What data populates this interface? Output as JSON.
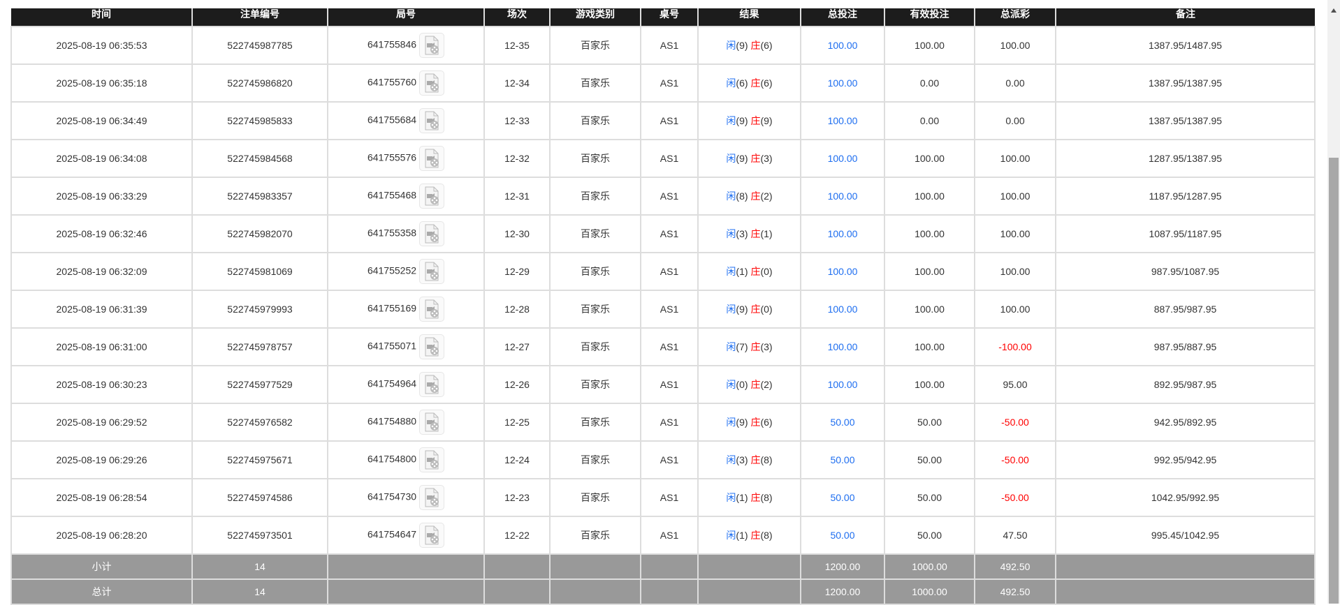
{
  "headers": [
    "时间",
    "注单编号",
    "局号",
    "场次",
    "游戏类别",
    "桌号",
    "结果",
    "总投注",
    "有效投注",
    "总派彩",
    "备注"
  ],
  "result_labels": {
    "player": "闲",
    "banker": "庄"
  },
  "colors": {
    "header_bg": "#1c1c1c",
    "summary_bg": "#999999",
    "blue": "#1e6ef0",
    "red": "#ff0000"
  },
  "rows": [
    {
      "time": "2025-08-19 06:35:53",
      "bet_id": "522745987785",
      "round": "641755846",
      "shoe": "12-35",
      "game": "百家乐",
      "table": "AS1",
      "player": "(9)",
      "banker": "(6)",
      "total_bet": "100.00",
      "valid_bet": "100.00",
      "payout": "100.00",
      "payout_negative": false,
      "note": "1387.95/1487.95"
    },
    {
      "time": "2025-08-19 06:35:18",
      "bet_id": "522745986820",
      "round": "641755760",
      "shoe": "12-34",
      "game": "百家乐",
      "table": "AS1",
      "player": "(6)",
      "banker": "(6)",
      "total_bet": "100.00",
      "valid_bet": "0.00",
      "payout": "0.00",
      "payout_negative": false,
      "note": "1387.95/1387.95"
    },
    {
      "time": "2025-08-19 06:34:49",
      "bet_id": "522745985833",
      "round": "641755684",
      "shoe": "12-33",
      "game": "百家乐",
      "table": "AS1",
      "player": "(9)",
      "banker": "(9)",
      "total_bet": "100.00",
      "valid_bet": "0.00",
      "payout": "0.00",
      "payout_negative": false,
      "note": "1387.95/1387.95"
    },
    {
      "time": "2025-08-19 06:34:08",
      "bet_id": "522745984568",
      "round": "641755576",
      "shoe": "12-32",
      "game": "百家乐",
      "table": "AS1",
      "player": "(9)",
      "banker": "(3)",
      "total_bet": "100.00",
      "valid_bet": "100.00",
      "payout": "100.00",
      "payout_negative": false,
      "note": "1287.95/1387.95"
    },
    {
      "time": "2025-08-19 06:33:29",
      "bet_id": "522745983357",
      "round": "641755468",
      "shoe": "12-31",
      "game": "百家乐",
      "table": "AS1",
      "player": "(8)",
      "banker": "(2)",
      "total_bet": "100.00",
      "valid_bet": "100.00",
      "payout": "100.00",
      "payout_negative": false,
      "note": "1187.95/1287.95"
    },
    {
      "time": "2025-08-19 06:32:46",
      "bet_id": "522745982070",
      "round": "641755358",
      "shoe": "12-30",
      "game": "百家乐",
      "table": "AS1",
      "player": "(3)",
      "banker": "(1)",
      "total_bet": "100.00",
      "valid_bet": "100.00",
      "payout": "100.00",
      "payout_negative": false,
      "note": "1087.95/1187.95"
    },
    {
      "time": "2025-08-19 06:32:09",
      "bet_id": "522745981069",
      "round": "641755252",
      "shoe": "12-29",
      "game": "百家乐",
      "table": "AS1",
      "player": "(1)",
      "banker": "(0)",
      "total_bet": "100.00",
      "valid_bet": "100.00",
      "payout": "100.00",
      "payout_negative": false,
      "note": "987.95/1087.95"
    },
    {
      "time": "2025-08-19 06:31:39",
      "bet_id": "522745979993",
      "round": "641755169",
      "shoe": "12-28",
      "game": "百家乐",
      "table": "AS1",
      "player": "(9)",
      "banker": "(0)",
      "total_bet": "100.00",
      "valid_bet": "100.00",
      "payout": "100.00",
      "payout_negative": false,
      "note": "887.95/987.95"
    },
    {
      "time": "2025-08-19 06:31:00",
      "bet_id": "522745978757",
      "round": "641755071",
      "shoe": "12-27",
      "game": "百家乐",
      "table": "AS1",
      "player": "(7)",
      "banker": "(3)",
      "total_bet": "100.00",
      "valid_bet": "100.00",
      "payout": "-100.00",
      "payout_negative": true,
      "note": "987.95/887.95"
    },
    {
      "time": "2025-08-19 06:30:23",
      "bet_id": "522745977529",
      "round": "641754964",
      "shoe": "12-26",
      "game": "百家乐",
      "table": "AS1",
      "player": "(0)",
      "banker": "(2)",
      "total_bet": "100.00",
      "valid_bet": "100.00",
      "payout": "95.00",
      "payout_negative": false,
      "note": "892.95/987.95"
    },
    {
      "time": "2025-08-19 06:29:52",
      "bet_id": "522745976582",
      "round": "641754880",
      "shoe": "12-25",
      "game": "百家乐",
      "table": "AS1",
      "player": "(9)",
      "banker": "(6)",
      "total_bet": "50.00",
      "valid_bet": "50.00",
      "payout": "-50.00",
      "payout_negative": true,
      "note": "942.95/892.95"
    },
    {
      "time": "2025-08-19 06:29:26",
      "bet_id": "522745975671",
      "round": "641754800",
      "shoe": "12-24",
      "game": "百家乐",
      "table": "AS1",
      "player": "(3)",
      "banker": "(8)",
      "total_bet": "50.00",
      "valid_bet": "50.00",
      "payout": "-50.00",
      "payout_negative": true,
      "note": "992.95/942.95"
    },
    {
      "time": "2025-08-19 06:28:54",
      "bet_id": "522745974586",
      "round": "641754730",
      "shoe": "12-23",
      "game": "百家乐",
      "table": "AS1",
      "player": "(1)",
      "banker": "(8)",
      "total_bet": "50.00",
      "valid_bet": "50.00",
      "payout": "-50.00",
      "payout_negative": true,
      "note": "1042.95/992.95"
    },
    {
      "time": "2025-08-19 06:28:20",
      "bet_id": "522745973501",
      "round": "641754647",
      "shoe": "12-22",
      "game": "百家乐",
      "table": "AS1",
      "player": "(1)",
      "banker": "(8)",
      "total_bet": "50.00",
      "valid_bet": "50.00",
      "payout": "47.50",
      "payout_negative": false,
      "note": "995.45/1042.95"
    }
  ],
  "subtotal": {
    "label": "小计",
    "count": "14",
    "total_bet": "1200.00",
    "valid_bet": "1000.00",
    "payout": "492.50"
  },
  "total": {
    "label": "总计",
    "count": "14",
    "total_bet": "1200.00",
    "valid_bet": "1000.00",
    "payout": "492.50"
  }
}
